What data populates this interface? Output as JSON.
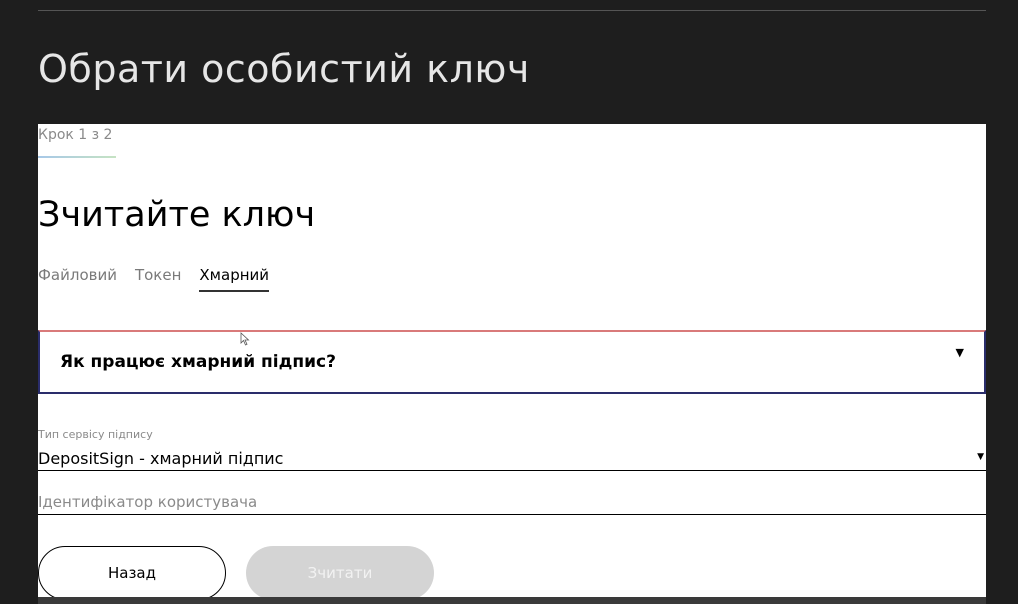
{
  "header": {
    "title": "Обрати особистий ключ"
  },
  "card": {
    "step": "Крок 1 з 2",
    "heading": "Зчитайте ключ",
    "tabs": [
      {
        "label": "Файловий",
        "active": false
      },
      {
        "label": "Токен",
        "active": false
      },
      {
        "label": "Хмарний",
        "active": true
      }
    ],
    "accordion": {
      "title": "Як працює хмарний підпис?",
      "caret_icon": "caret-down-icon"
    },
    "service_type": {
      "label": "Тип сервісу підпису",
      "value": "DepositSign - хмарний підпис"
    },
    "user_id": {
      "value": "",
      "placeholder": "Ідентифікатор користувача"
    },
    "buttons": {
      "back_label": "Назад",
      "read_label": "Зчитати"
    }
  },
  "colors": {
    "background": "#1e1e1e",
    "card": "#ffffff",
    "accordion_border": "#2a2d6b",
    "disabled_button": "#d4d4d4"
  }
}
